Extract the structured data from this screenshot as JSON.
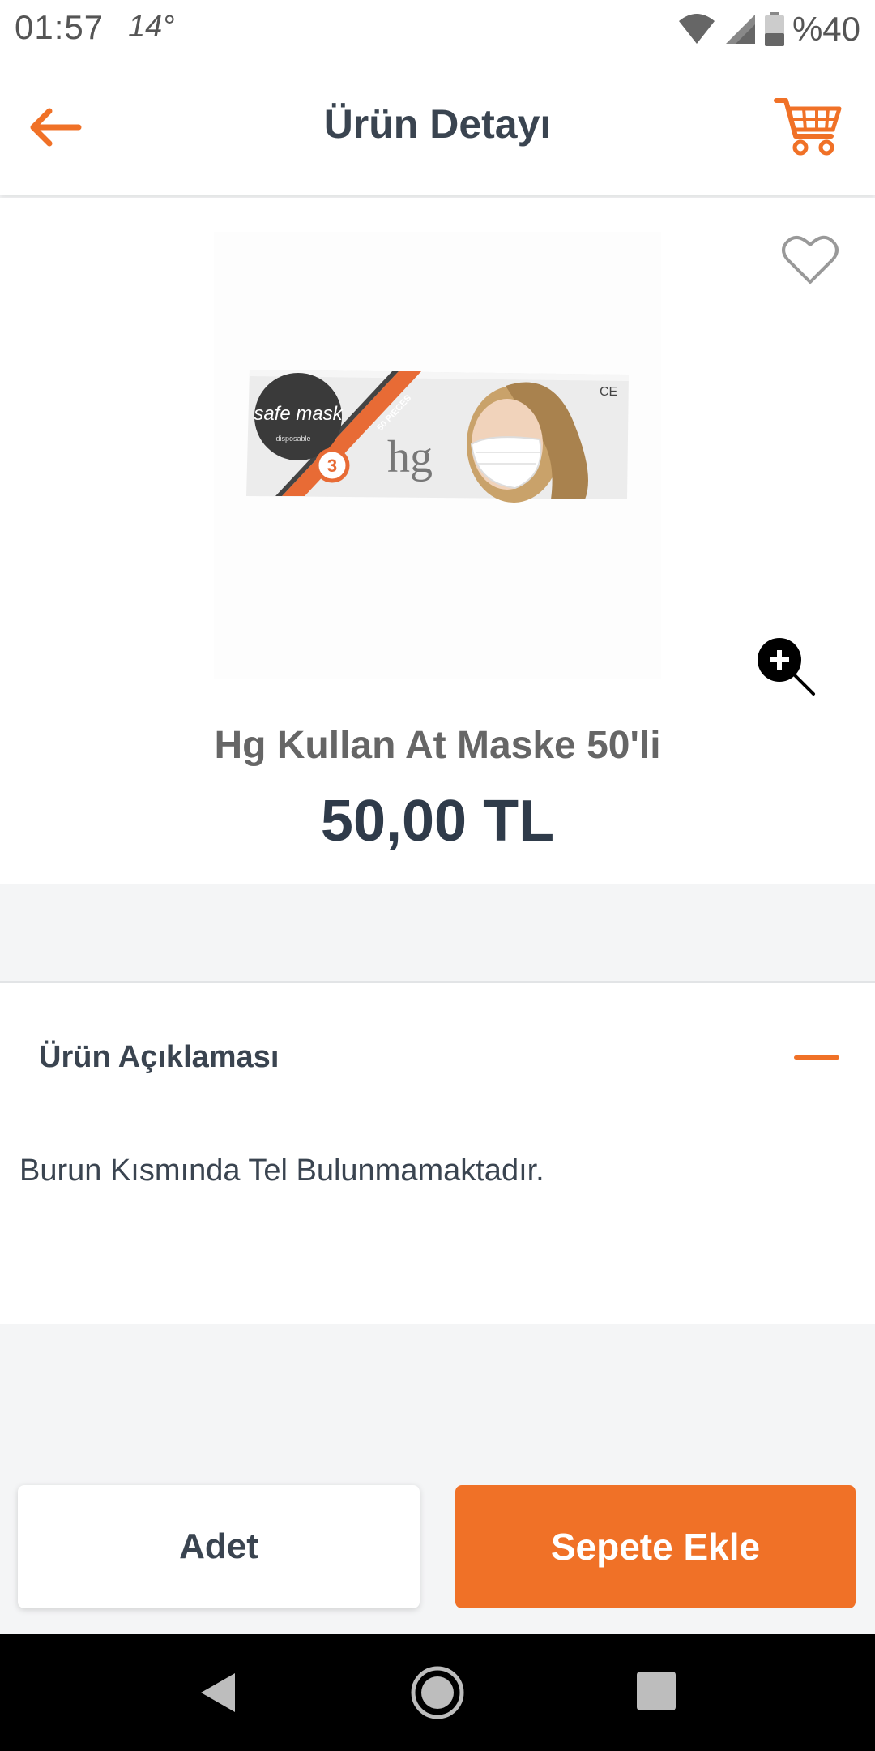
{
  "status_bar": {
    "time": "01:57",
    "temperature": "14°",
    "battery": "%40",
    "icons": [
      "wifi-icon",
      "cellular-signal-icon",
      "battery-icon"
    ]
  },
  "header": {
    "title": "Ürün Detayı",
    "back_icon": "arrow-left-icon",
    "cart_icon": "shopping-cart-icon"
  },
  "product": {
    "name": "Hg Kullan At Maske 50'li",
    "price": "50,00 TL",
    "image": {
      "box_brand": "safe mask",
      "box_subtitle": "disposable",
      "box_badge": "3",
      "box_stripe_text": "50 PIECES",
      "box_logo": "hg",
      "box_mark": "CE"
    },
    "favorite_icon": "heart-outline-icon",
    "zoom_icon": "zoom-in-icon"
  },
  "description": {
    "title": "Ürün Açıklaması",
    "text": "Burun Kısmında Tel Bulunmamaktadır.",
    "toggle_icon": "minus-icon"
  },
  "actions": {
    "quantity_label": "Adet",
    "add_to_cart_label": "Sepete Ekle"
  },
  "colors": {
    "accent": "#f07127",
    "title_text": "#3a4450",
    "background": "#f4f5f6"
  }
}
